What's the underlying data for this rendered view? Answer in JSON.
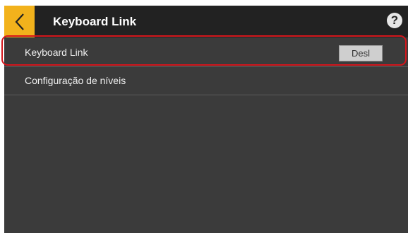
{
  "header": {
    "title": "Keyboard Link",
    "back_icon": "chevron-left-icon",
    "help_icon": "help-icon",
    "help_glyph": "?",
    "back_color": "#f2b21c"
  },
  "settings": [
    {
      "label": "Keyboard Link",
      "value": "Desl"
    },
    {
      "label": "Configuração de níveis"
    }
  ],
  "highlight_color": "#d4161c"
}
